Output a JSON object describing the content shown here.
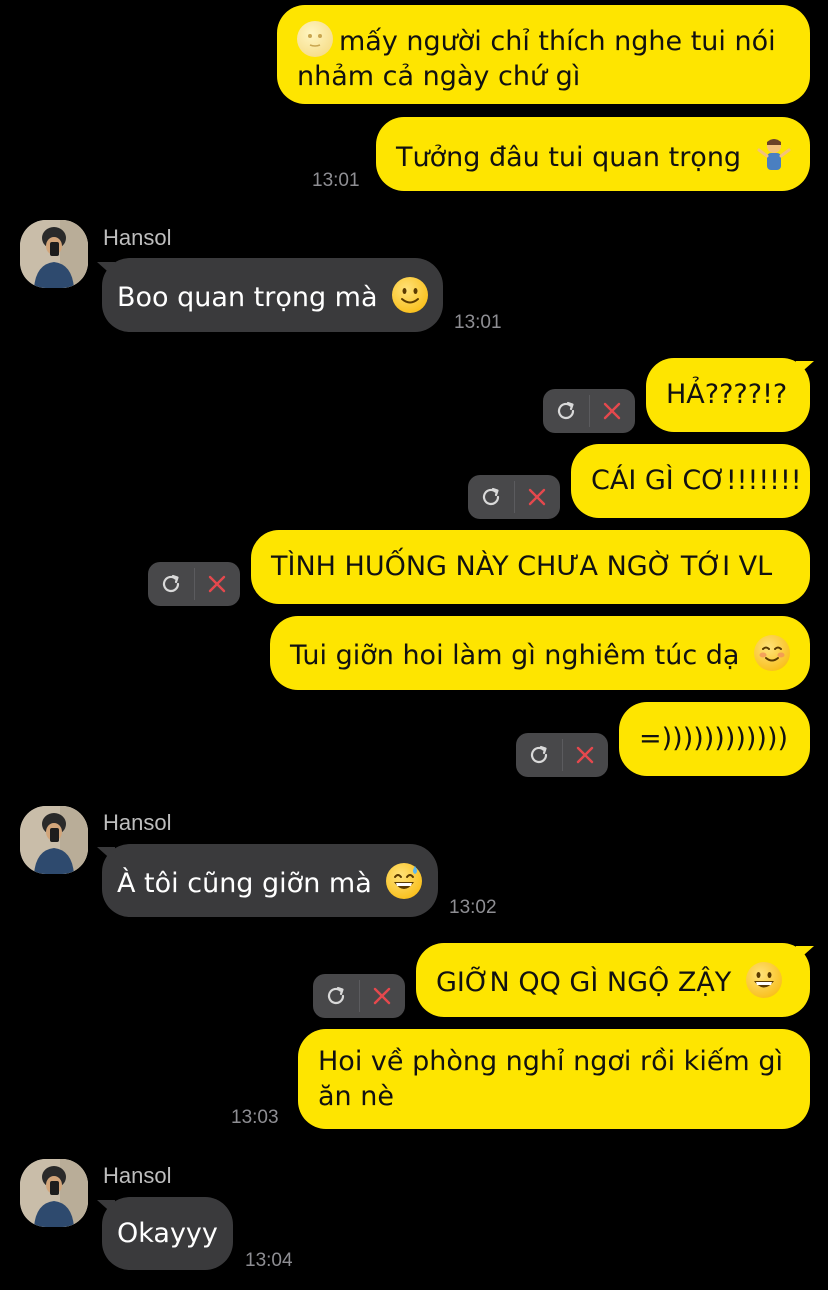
{
  "conversation": {
    "contact_name": "Hansol",
    "messages": [
      {
        "id": "m1",
        "from": "me",
        "lines": [
          "mấy người chỉ thích nghe tui nói",
          "nhảm cả ngày chứ gì"
        ],
        "emoji": "new-moon-face",
        "emoji_position": "start"
      },
      {
        "id": "m2",
        "from": "me",
        "text": "Tưởng đâu tui quan trọng",
        "emoji": "person-shrugging",
        "time": "13:01"
      },
      {
        "id": "m3",
        "from": "Hansol",
        "text": "Boo quan trọng mà",
        "emoji": "slightly-smiling-face",
        "time": "13:01"
      },
      {
        "id": "m4",
        "from": "me",
        "text": "HẢ????!?",
        "failed": true
      },
      {
        "id": "m5",
        "from": "me",
        "text": "CÁI GÌ CƠ!!!!!!!",
        "failed": true
      },
      {
        "id": "m6",
        "from": "me",
        "text": "TÌNH HUỐNG NÀY CHƯA NGỜ TỚI VL",
        "failed": true
      },
      {
        "id": "m7",
        "from": "me",
        "text": "Tui giỡn hoi làm gì nghiêm túc dạ",
        "emoji": "smiling-face"
      },
      {
        "id": "m8",
        "from": "me",
        "text": "=))))))))))))",
        "failed": true
      },
      {
        "id": "m9",
        "from": "Hansol",
        "text": "À tôi cũng giỡn mà",
        "emoji": "grinning-face-with-sweat",
        "time": "13:02"
      },
      {
        "id": "m10",
        "from": "me",
        "text": "GIỠN QQ GÌ NGỘ ZẬY",
        "emoji": "grinning-face",
        "failed": true
      },
      {
        "id": "m11",
        "from": "me",
        "lines": [
          "Hoi về phòng nghỉ ngơi rồi kiếm gì",
          "ăn nè"
        ],
        "time": "13:03"
      },
      {
        "id": "m12",
        "from": "Hansol",
        "text": "Okayyy",
        "time": "13:04"
      }
    ]
  },
  "colors": {
    "background": "#000000",
    "outgoing_bubble": "#FEE500",
    "incoming_bubble": "#3A3A3C",
    "failed_actions_bg": "#48484A",
    "delete_icon": "#E5484D",
    "timestamp": "#8E8E93"
  },
  "icons": {
    "retry": "retry-icon",
    "delete": "delete-icon"
  }
}
